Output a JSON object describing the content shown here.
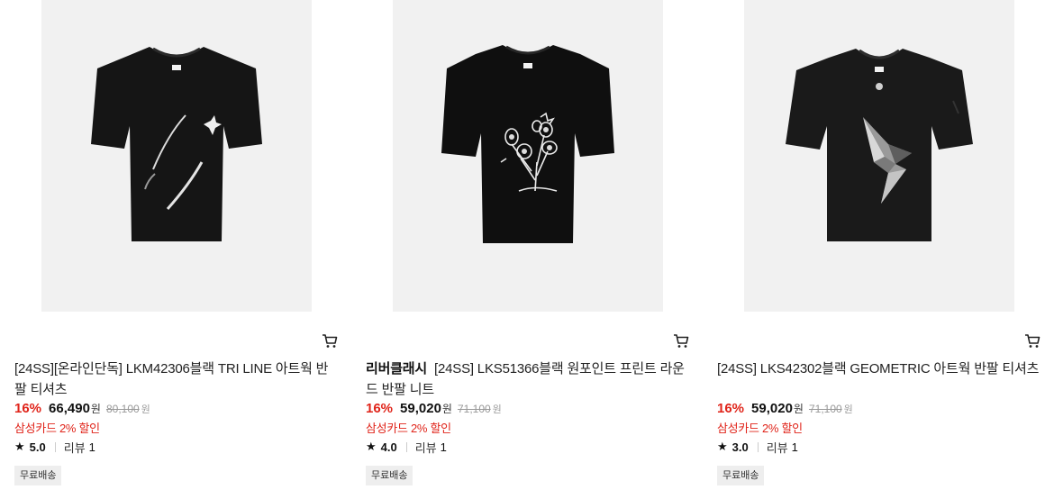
{
  "products": [
    {
      "brand": "",
      "name": "[24SS][온라인단독] LKM42306블랙 TRI LINE 아트웍 반팔 티셔츠",
      "discount": "16%",
      "price": "66,490",
      "currency": "원",
      "original_price": "80,100",
      "card_promo": "삼성카드 2% 할인",
      "rating": "5.0",
      "review_label": "리뷰",
      "review_count": "1",
      "badge": "무료배송",
      "print": "tri-line-slashes"
    },
    {
      "brand": "리버클래시",
      "name": "[24SS] LKS51366블랙 원포인트 프린트 라운드 반팔 니트",
      "discount": "16%",
      "price": "59,020",
      "currency": "원",
      "original_price": "71,100",
      "card_promo": "삼성카드 2% 할인",
      "rating": "4.0",
      "review_label": "리뷰",
      "review_count": "1",
      "badge": "무료배송",
      "print": "floral"
    },
    {
      "brand": "",
      "name": "[24SS] LKS42302블랙 GEOMETRIC 아트웍 반팔 티셔츠",
      "discount": "16%",
      "price": "59,020",
      "currency": "원",
      "original_price": "71,100",
      "card_promo": "삼성카드 2% 할인",
      "rating": "3.0",
      "review_label": "리뷰",
      "review_count": "1",
      "badge": "무료배송",
      "print": "geometric"
    }
  ],
  "icons": {
    "cart": "cart-icon",
    "star": "star-icon"
  },
  "colors": {
    "discount": "#e0241a",
    "thumb_bg": "#f1f1f1",
    "shirt": "#111111"
  }
}
